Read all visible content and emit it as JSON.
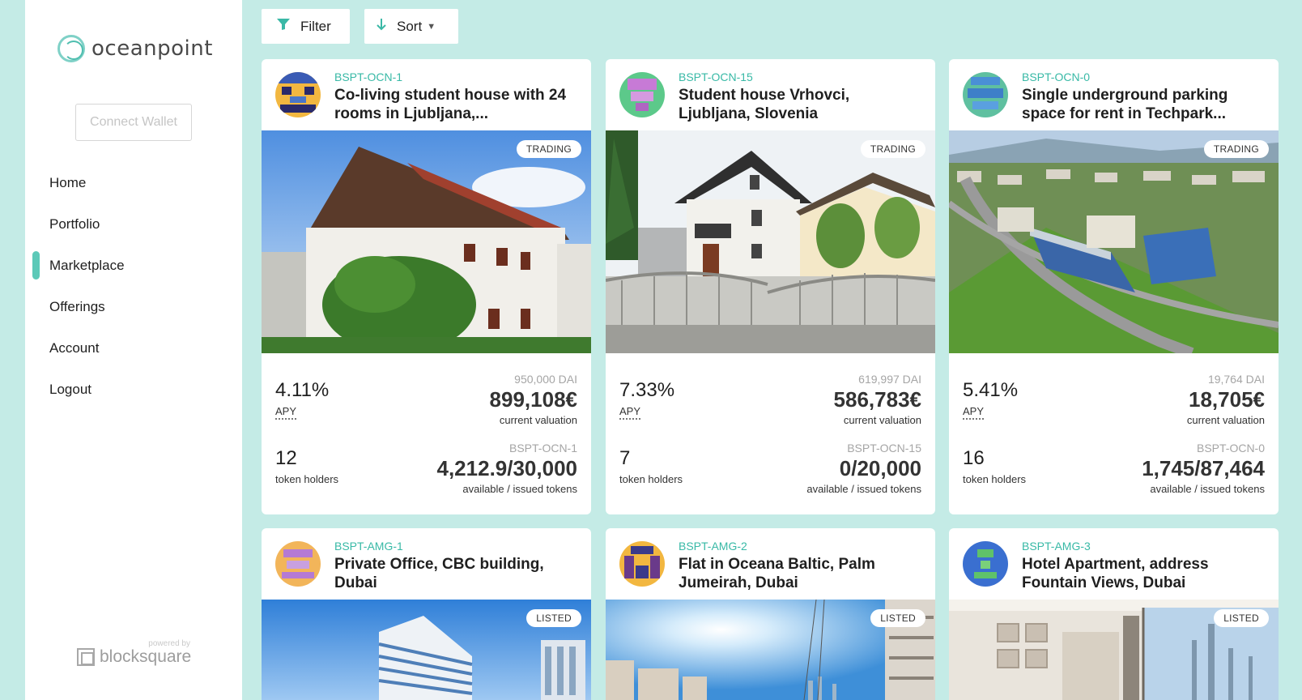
{
  "brand": {
    "name": "oceanpoint",
    "accent": "#5cc9b8"
  },
  "sidebar": {
    "connect_wallet": "Connect Wallet",
    "items": [
      {
        "label": "Home",
        "active": false
      },
      {
        "label": "Portfolio",
        "active": false
      },
      {
        "label": "Marketplace",
        "active": true
      },
      {
        "label": "Offerings",
        "active": false
      },
      {
        "label": "Account",
        "active": false
      },
      {
        "label": "Logout",
        "active": false
      }
    ],
    "powered_by": "powered by",
    "powered_brand": "blocksquare"
  },
  "toolbar": {
    "filter_label": "Filter",
    "filter_icon": "filter-icon",
    "sort_label": "Sort",
    "sort_icon": "arrow-down-icon"
  },
  "cards": [
    {
      "code": "BSPT-OCN-1",
      "title": "Co-living student house with 24 rooms in Ljubljana,...",
      "status": "TRADING",
      "apy": "4.11%",
      "apy_label": "APY",
      "valuation_dai": "950,000 DAI",
      "valuation": "899,108€",
      "valuation_label": "current valuation",
      "holders": "12",
      "holders_label": "token holders",
      "token_code": "BSPT-OCN-1",
      "tokens": "4,212.9/30,000",
      "tokens_label": "available / issued tokens"
    },
    {
      "code": "BSPT-OCN-15",
      "title": "Student house Vrhovci, Ljubljana, Slovenia",
      "status": "TRADING",
      "apy": "7.33%",
      "apy_label": "APY",
      "valuation_dai": "619,997 DAI",
      "valuation": "586,783€",
      "valuation_label": "current valuation",
      "holders": "7",
      "holders_label": "token holders",
      "token_code": "BSPT-OCN-15",
      "tokens": "0/20,000",
      "tokens_label": "available / issued tokens"
    },
    {
      "code": "BSPT-OCN-0",
      "title": "Single underground parking space for rent in Techpark...",
      "status": "TRADING",
      "apy": "5.41%",
      "apy_label": "APY",
      "valuation_dai": "19,764 DAI",
      "valuation": "18,705€",
      "valuation_label": "current valuation",
      "holders": "16",
      "holders_label": "token holders",
      "token_code": "BSPT-OCN-0",
      "tokens": "1,745/87,464",
      "tokens_label": "available / issued tokens"
    },
    {
      "code": "BSPT-AMG-1",
      "title": "Private Office, CBC building, Dubai",
      "status": "LISTED"
    },
    {
      "code": "BSPT-AMG-2",
      "title": "Flat in Oceana Baltic, Palm Jumeirah, Dubai",
      "status": "LISTED"
    },
    {
      "code": "BSPT-AMG-3",
      "title": "Hotel Apartment, address Fountain Views, Dubai",
      "status": "LISTED"
    }
  ]
}
